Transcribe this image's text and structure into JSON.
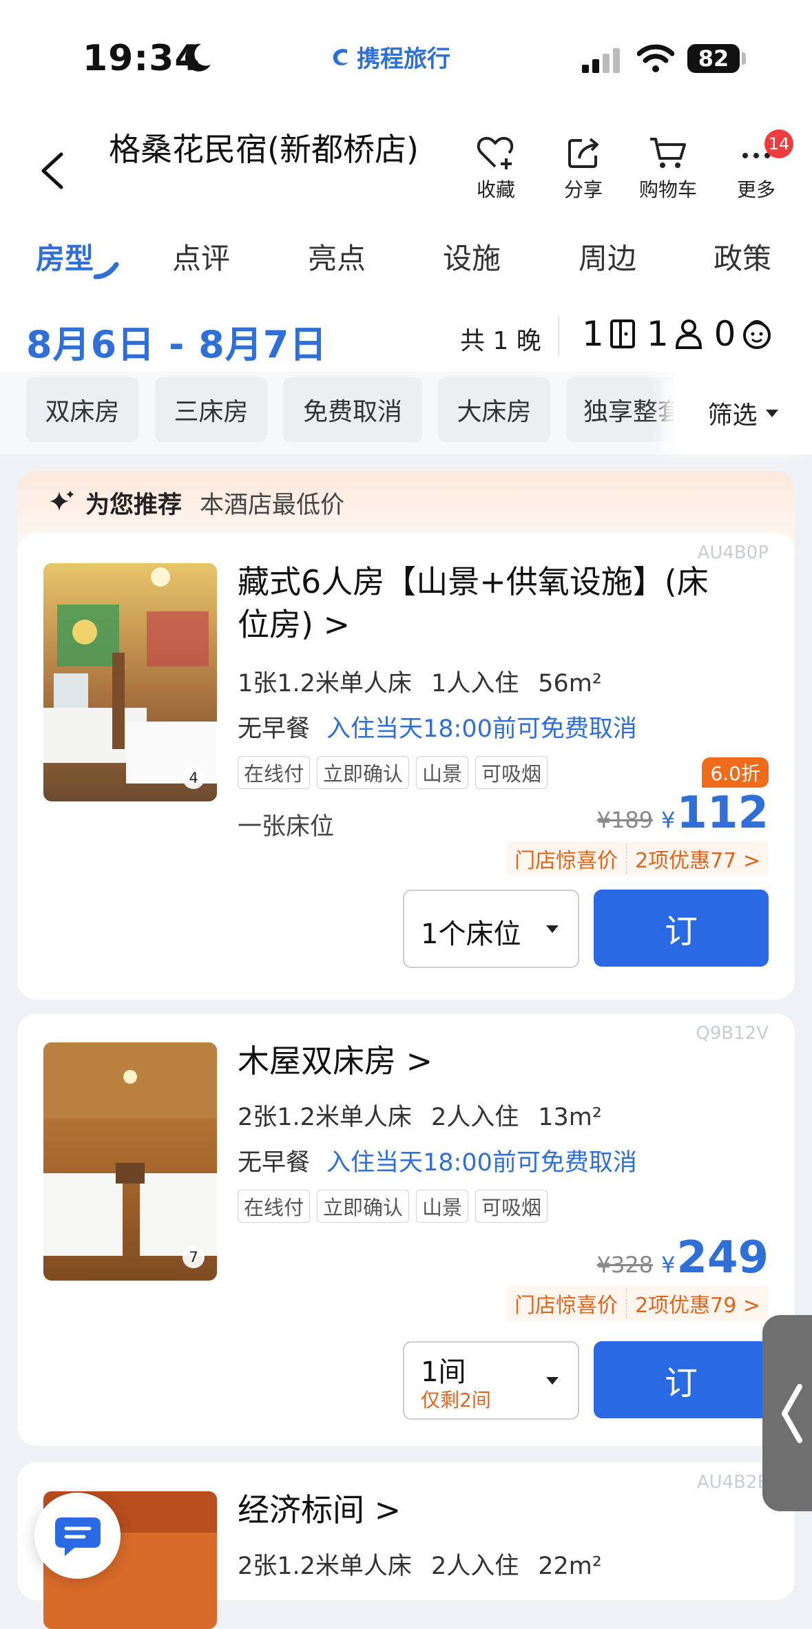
{
  "status_bar": {
    "time": "19:34",
    "brand": "携程旅行",
    "battery": "82"
  },
  "header": {
    "title": "格桑花民宿(新都桥店)",
    "actions": [
      {
        "label": "收藏",
        "icon": "heart-plus-icon"
      },
      {
        "label": "分享",
        "icon": "share-icon"
      },
      {
        "label": "购物车",
        "icon": "cart-icon"
      },
      {
        "label": "更多",
        "icon": "more-icon"
      }
    ],
    "more_badge": "14"
  },
  "tabs": [
    {
      "label": "房型",
      "active": true
    },
    {
      "label": "点评"
    },
    {
      "label": "亮点"
    },
    {
      "label": "设施"
    },
    {
      "label": "周边"
    },
    {
      "label": "政策"
    }
  ],
  "date_bar": {
    "dates": "8月6日 - 8月7日",
    "nights": "共 1 晚",
    "rooms": "1",
    "adults": "1",
    "children": "0"
  },
  "filters": {
    "chips": [
      "双床房",
      "三床房",
      "免费取消",
      "大床房",
      "独享整套"
    ],
    "filter_label": "筛选"
  },
  "recommend": {
    "title": "为您推荐",
    "subtitle": "本酒店最低价"
  },
  "rooms": [
    {
      "code": "AU4B0P",
      "name_line1": "藏式6人房【山景+供氧设施】(床",
      "name_line2": "位房) >",
      "bed": "1张1.2米单人床",
      "occupancy": "1人入住",
      "area": "56m²",
      "breakfast": "无早餐",
      "cancel": "入住当天18:00前可免费取消",
      "tags": [
        "在线付",
        "立即确认",
        "山景",
        "可吸烟"
      ],
      "note": "一张床位",
      "discount": "6.0折",
      "orig_price": "¥189",
      "currency": "¥",
      "price": "112",
      "promo_a": "门店惊喜价",
      "promo_b": "2项优惠77 >",
      "qty": "1个床位",
      "book": "订",
      "photo_count": "4"
    },
    {
      "code": "Q9B12V",
      "name": "木屋双床房 >",
      "bed": "2张1.2米单人床",
      "occupancy": "2人入住",
      "area": "13m²",
      "breakfast": "无早餐",
      "cancel": "入住当天18:00前可免费取消",
      "tags": [
        "在线付",
        "立即确认",
        "山景",
        "可吸烟"
      ],
      "orig_price": "¥328",
      "currency": "¥",
      "price": "249",
      "promo_a": "门店惊喜价",
      "promo_b": "2项优惠79 >",
      "qty": "1间",
      "qty_sub": "仅剩2间",
      "book": "订",
      "photo_count": "7"
    },
    {
      "code": "AU4B2E",
      "name": "经济标间 >",
      "bed": "2张1.2米单人床",
      "occupancy": "2人入住",
      "area": "22m²"
    }
  ],
  "colors": {
    "accent": "#2f6fd8",
    "book_button": "#2a69e4",
    "promo": "#e0651a",
    "discount": "#f06c1c"
  }
}
